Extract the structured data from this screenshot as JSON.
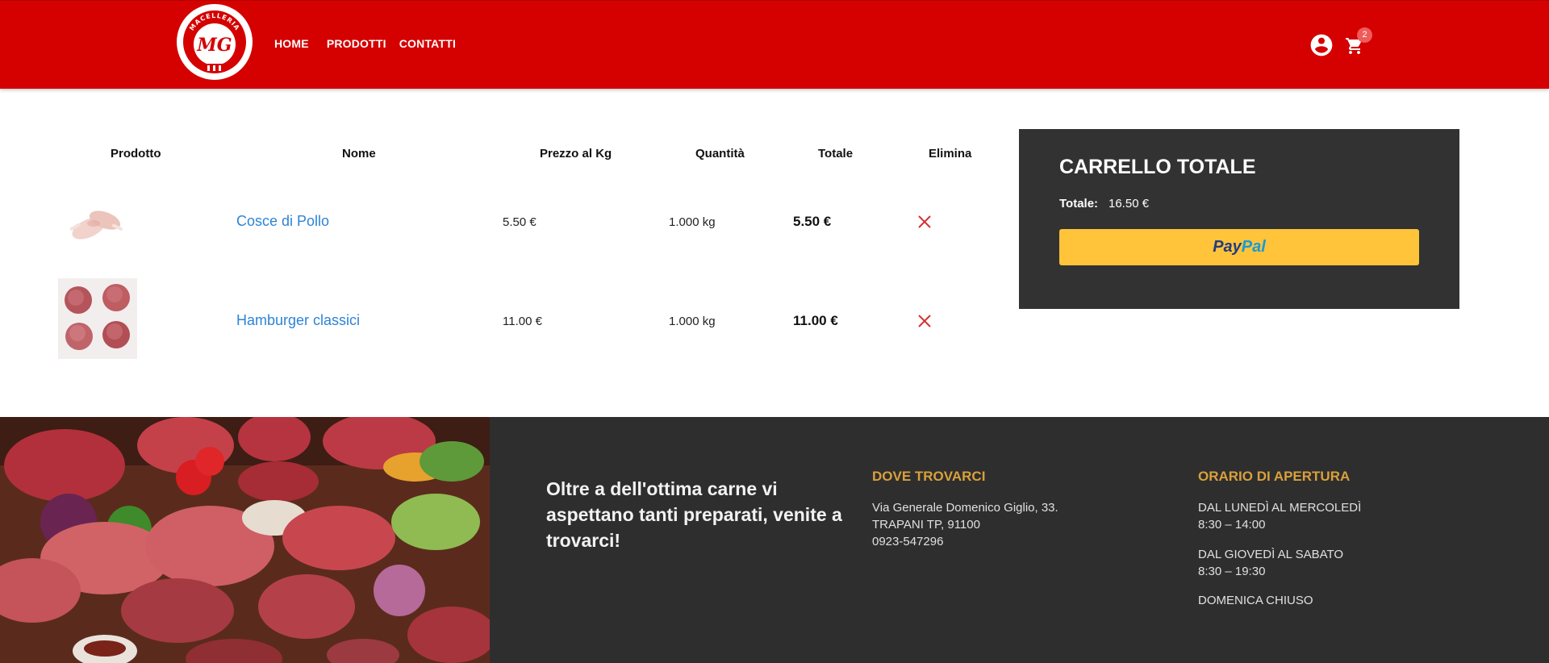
{
  "header": {
    "logo_text": "MACELLERIA",
    "logo_monogram": "MG",
    "nav": [
      {
        "label": "HOME"
      },
      {
        "label": "PRODOTTI"
      },
      {
        "label": "CONTATTI"
      }
    ],
    "cart_count": "2",
    "brand_color": "#d50000"
  },
  "table": {
    "headers": {
      "product": "Prodotto",
      "name": "Nome",
      "price": "Prezzo al Kg",
      "qty": "Quantità",
      "total": "Totale",
      "delete": "Elimina"
    },
    "rows": [
      {
        "image": "chicken-legs",
        "name": "Cosce di Pollo",
        "price": "5.50 €",
        "qty": "1.000 kg",
        "total": "5.50 €"
      },
      {
        "image": "hamburger-patties",
        "name": "Hamburger classici",
        "price": "11.00 €",
        "qty": "1.000 kg",
        "total": "11.00 €"
      }
    ],
    "delete_icon": "close-x-icon",
    "link_color": "#2d84d6"
  },
  "summary": {
    "title": "CARRELLO TOTALE",
    "total_label": "Totale:",
    "total_value": "16.50 €",
    "paypal_part1": "Pay",
    "paypal_part2": "Pal",
    "paypal_color": "#ffc43a"
  },
  "footer": {
    "tagline": "Oltre a dell'ottima carne vi aspettano tanti preparati, venite a trovarci!",
    "where": {
      "title": "DOVE TROVARCI",
      "lines": [
        "Via Generale Domenico Giglio, 33.",
        "TRAPANI TP, 91100",
        "0923-547296"
      ]
    },
    "hours": {
      "title": "ORARIO DI APERTURA",
      "lines": [
        "DAL LUNEDÌ AL MERCOLEDÌ",
        "8:30 – 14:00",
        "DAL GIOVEDÌ AL SABATO",
        "8:30 – 19:30",
        "DOMENICA CHIUSO"
      ]
    },
    "accent_color": "#d9a03b"
  }
}
